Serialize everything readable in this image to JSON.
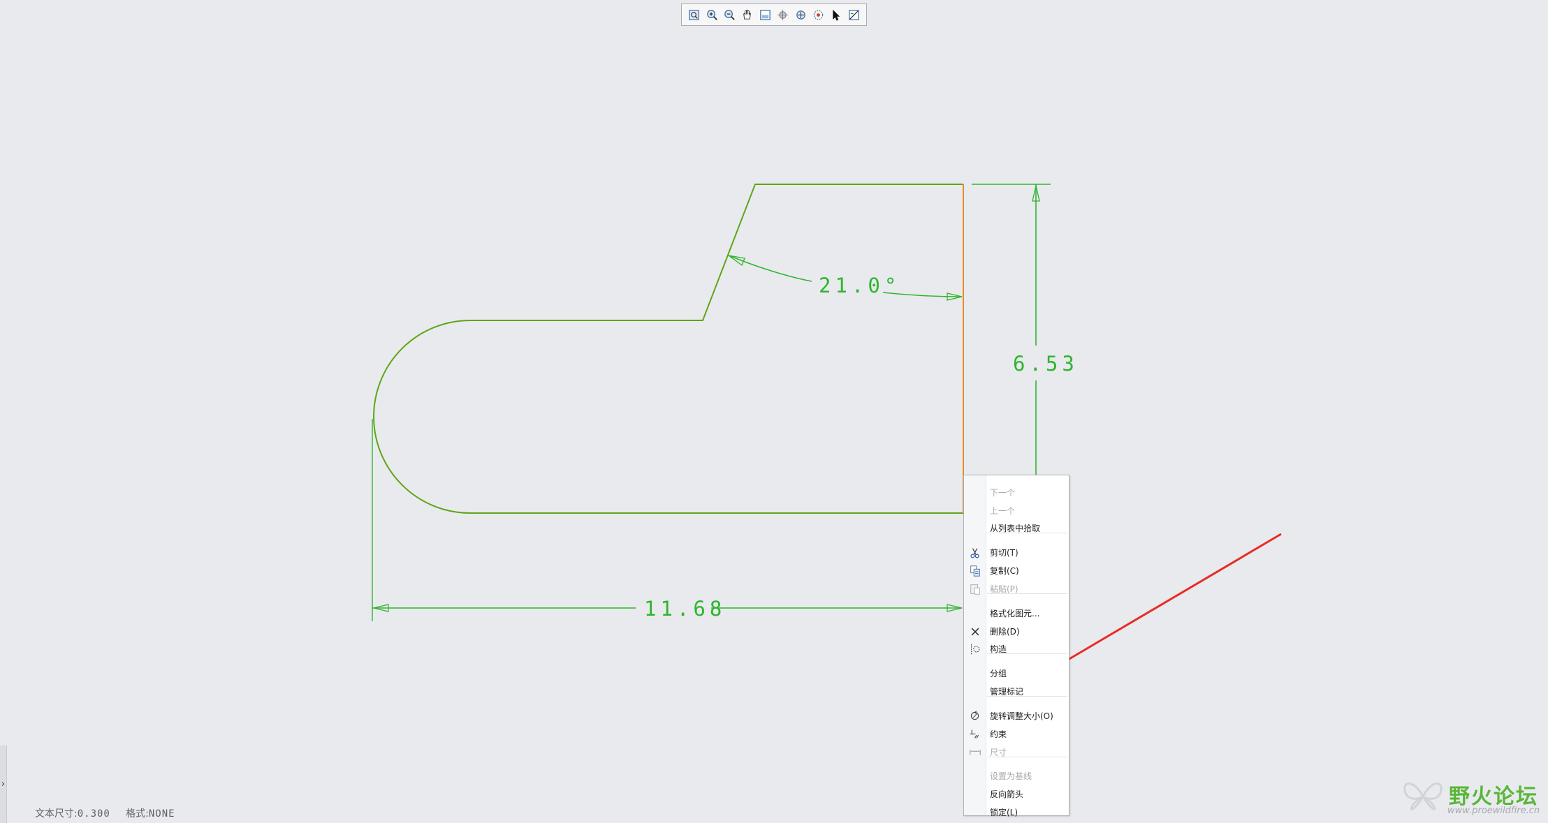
{
  "toolbar": {
    "icons": [
      "refit-icon",
      "zoom-in-icon",
      "zoom-out-icon",
      "pan-icon",
      "saved-view-icon",
      "display-style-icon",
      "reorient-icon",
      "spin-center-icon",
      "select-icon",
      "sketch-view-icon"
    ]
  },
  "drawing": {
    "angle_dim": "21.0°",
    "height_dim": "6.53",
    "width_dim": "11.68"
  },
  "context_menu": {
    "items": [
      {
        "label": "下一个",
        "disabled": true,
        "icon": ""
      },
      {
        "label": "上一个",
        "disabled": true,
        "icon": ""
      },
      {
        "label": "从列表中拾取",
        "disabled": false,
        "icon": ""
      },
      {
        "label": "剪切(T)",
        "disabled": false,
        "icon": "scissors-icon"
      },
      {
        "label": "复制(C)",
        "disabled": false,
        "icon": "copy-icon"
      },
      {
        "label": "粘贴(P)",
        "disabled": true,
        "icon": "paste-icon"
      },
      {
        "label": "格式化图元...",
        "disabled": false,
        "icon": ""
      },
      {
        "label": "删除(D)",
        "disabled": false,
        "icon": "delete-icon"
      },
      {
        "label": "构造",
        "disabled": false,
        "icon": "construction-icon"
      },
      {
        "label": "分组",
        "disabled": false,
        "icon": ""
      },
      {
        "label": "管理标记",
        "disabled": false,
        "icon": ""
      },
      {
        "label": "旋转调整大小(O)",
        "disabled": false,
        "icon": "rotate-resize-icon"
      },
      {
        "label": "约束",
        "disabled": false,
        "icon": "constraint-icon"
      },
      {
        "label": "尺寸",
        "disabled": true,
        "icon": "dimension-icon"
      },
      {
        "label": "设置为基线",
        "disabled": true,
        "icon": ""
      },
      {
        "label": "反向箭头",
        "disabled": false,
        "icon": ""
      },
      {
        "label": "锁定(L)",
        "disabled": false,
        "icon": ""
      }
    ]
  },
  "status": {
    "text_size_label": "文本尺寸:",
    "text_size_value": "0.300",
    "format_label": "格式:",
    "format_value": "NONE"
  },
  "watermark": {
    "text": "野火论坛",
    "url": "www.proewildfire.cn"
  },
  "colors": {
    "sketch": "#5ea517",
    "selected": "#e68a1f",
    "dimension": "#2fb52f",
    "annotation_arrow": "#e82c25",
    "background": "#e9eaed"
  }
}
